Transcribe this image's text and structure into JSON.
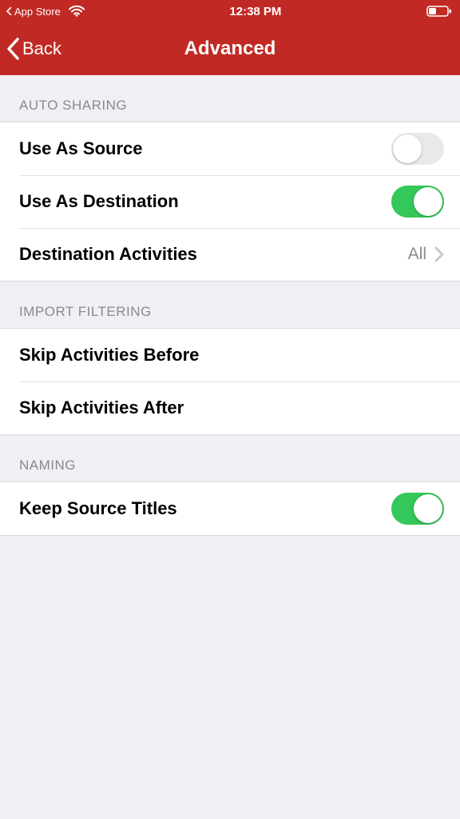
{
  "status": {
    "app": "App Store",
    "time": "12:38 PM"
  },
  "nav": {
    "back": "Back",
    "title": "Advanced"
  },
  "sections": {
    "autoSharing": {
      "header": "AUTO SHARING",
      "useAsSource": {
        "label": "Use As Source",
        "on": false
      },
      "useAsDestination": {
        "label": "Use As Destination",
        "on": true
      },
      "destinationActivities": {
        "label": "Destination Activities",
        "value": "All"
      }
    },
    "importFiltering": {
      "header": "IMPORT FILTERING",
      "skipBefore": {
        "label": "Skip Activities Before"
      },
      "skipAfter": {
        "label": "Skip Activities After"
      }
    },
    "naming": {
      "header": "NAMING",
      "keepSourceTitles": {
        "label": "Keep Source Titles",
        "on": true
      }
    }
  }
}
